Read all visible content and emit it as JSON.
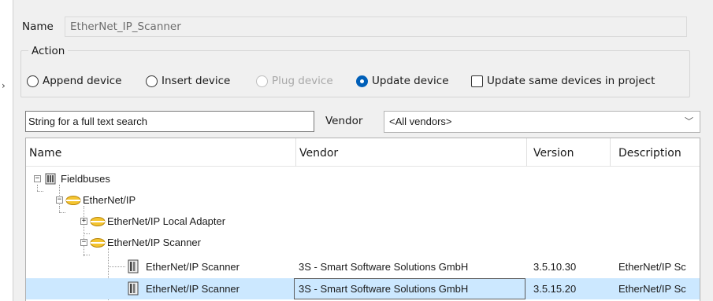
{
  "name_field": {
    "label": "Name",
    "value": "EtherNet_IP_Scanner"
  },
  "action": {
    "title": "Action",
    "options": [
      {
        "label": "Append device",
        "selected": false,
        "enabled": true
      },
      {
        "label": "Insert device",
        "selected": false,
        "enabled": true
      },
      {
        "label": "Plug device",
        "selected": false,
        "enabled": false
      },
      {
        "label": "Update device",
        "selected": true,
        "enabled": true
      }
    ],
    "checkbox": {
      "label": "Update same devices in project",
      "checked": false
    }
  },
  "search": {
    "value": "String for a full text search"
  },
  "vendor": {
    "label": "Vendor",
    "selected": "<All vendors>"
  },
  "table": {
    "columns": [
      "Name",
      "Vendor",
      "Version",
      "Description"
    ],
    "rows": [
      {
        "name": "Fieldbuses",
        "vendor": "",
        "version": "",
        "description": "",
        "icon": "folder-icon",
        "expander": "minus"
      },
      {
        "name": "EtherNet/IP",
        "vendor": "",
        "version": "",
        "description": "",
        "icon": "network-icon",
        "expander": "minus"
      },
      {
        "name": "EtherNet/IP Local Adapter",
        "vendor": "",
        "version": "",
        "description": "",
        "icon": "network-icon",
        "expander": "plus"
      },
      {
        "name": "EtherNet/IP Scanner",
        "vendor": "",
        "version": "",
        "description": "",
        "icon": "network-icon",
        "expander": "minus"
      },
      {
        "name": "EtherNet/IP Scanner",
        "vendor": "3S - Smart Software Solutions GmbH",
        "version": "3.5.10.30",
        "description": "EtherNet/IP Sc",
        "icon": "device-icon",
        "expander": ""
      },
      {
        "name": "EtherNet/IP Scanner",
        "vendor": "3S - Smart Software Solutions GmbH",
        "version": "3.5.15.20",
        "description": "EtherNet/IP Sc",
        "icon": "device-icon",
        "expander": "",
        "selected": true
      }
    ]
  },
  "colors": {
    "accent": "#005fb8",
    "selection": "#cce8ff",
    "panel": "#f0f0f0"
  }
}
